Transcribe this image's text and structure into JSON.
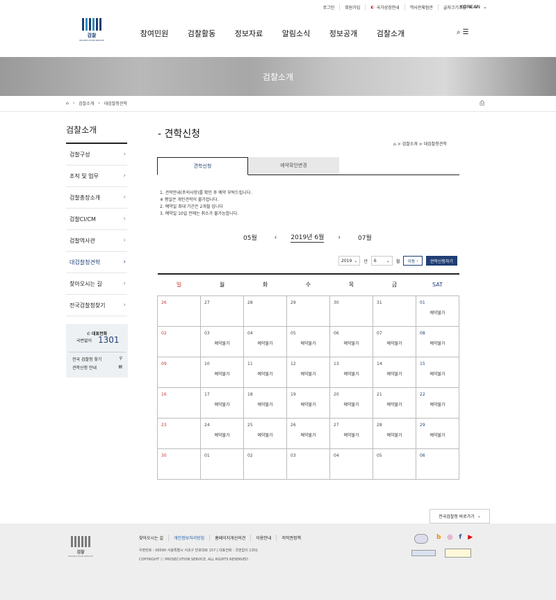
{
  "util_links": [
    "로그인",
    "회원가입",
    "국가상징안내",
    "역사관체험관",
    "글자크기조정"
  ],
  "language": "KOREAN",
  "logo": {
    "name": "검찰",
    "sub": "PROSECUTION SERVICE"
  },
  "gnb": [
    "참여민원",
    "검찰활동",
    "정보자료",
    "알림소식",
    "정보공개",
    "검찰소개"
  ],
  "hero_title": "검찰소개",
  "breadcrumb": [
    "검찰소개",
    "대검찰청견학"
  ],
  "sidebar": {
    "title": "검찰소개",
    "items": [
      "검찰구성",
      "조직 및 업무",
      "검찰총장소개",
      "검찰CI/CM",
      "검찰역사관",
      "대검찰청견학",
      "찾아오시는 길",
      "전국검찰청찾기"
    ],
    "call_label": "대표전화",
    "call_name": "국번없이",
    "call_number": "1301",
    "link1": "전국 검찰청 찾기",
    "link2": "견학신청 안내"
  },
  "page_title": "- 견학신청",
  "page_crumb": "> 검찰소개 > 대검찰청견학",
  "tabs": [
    "견학신청",
    "예약확인변경"
  ],
  "notes": [
    "1. 견학안내(주의사항)를 확인 후 예약 부탁드립니다.",
    "※ 평일은 개인견학이 불가합니다.",
    "2. 예약일 최대 기간은 2개월 입니다",
    "3. 예약일 10일 전에는 취소가 불가능합니다."
  ],
  "month_nav": {
    "prev": "05월",
    "current": "2019년 6월",
    "next": "07월"
  },
  "form": {
    "year": "2019",
    "year_unit": "년",
    "month": "6",
    "month_unit": "월",
    "go": "이동",
    "apply": "견학신청하기"
  },
  "weekdays": [
    "일",
    "월",
    "화",
    "수",
    "목",
    "금",
    "SAT"
  ],
  "calendar": [
    [
      {
        "d": "26",
        "r": ""
      },
      {
        "d": "27",
        "r": ""
      },
      {
        "d": "28",
        "r": ""
      },
      {
        "d": "29",
        "r": ""
      },
      {
        "d": "30",
        "r": ""
      },
      {
        "d": "31",
        "r": ""
      },
      {
        "d": "01",
        "r": "예약불가"
      }
    ],
    [
      {
        "d": "02",
        "r": ""
      },
      {
        "d": "03",
        "r": "예약불가"
      },
      {
        "d": "04",
        "r": "예약불가"
      },
      {
        "d": "05",
        "r": "예약불가"
      },
      {
        "d": "06",
        "r": "예약불가"
      },
      {
        "d": "07",
        "r": "예약불가"
      },
      {
        "d": "08",
        "r": "예약불가"
      }
    ],
    [
      {
        "d": "09",
        "r": ""
      },
      {
        "d": "10",
        "r": "예약불가"
      },
      {
        "d": "11",
        "r": "예약불가"
      },
      {
        "d": "12",
        "r": "예약불가"
      },
      {
        "d": "13",
        "r": "예약불가"
      },
      {
        "d": "14",
        "r": "예약불가"
      },
      {
        "d": "15",
        "r": "예약불가"
      }
    ],
    [
      {
        "d": "16",
        "r": ""
      },
      {
        "d": "17",
        "r": "예약불가"
      },
      {
        "d": "18",
        "r": "예약불가"
      },
      {
        "d": "19",
        "r": "예약불가"
      },
      {
        "d": "20",
        "r": "예약불가"
      },
      {
        "d": "21",
        "r": "예약불가"
      },
      {
        "d": "22",
        "r": "예약불가"
      }
    ],
    [
      {
        "d": "23",
        "r": ""
      },
      {
        "d": "24",
        "r": "예약불가"
      },
      {
        "d": "25",
        "r": "예약불가"
      },
      {
        "d": "26",
        "r": "예약불가"
      },
      {
        "d": "27",
        "r": "예약불가"
      },
      {
        "d": "28",
        "r": "예약불가"
      },
      {
        "d": "29",
        "r": "예약불가"
      }
    ],
    [
      {
        "d": "30",
        "r": ""
      },
      {
        "d": "01",
        "r": ""
      },
      {
        "d": "02",
        "r": ""
      },
      {
        "d": "03",
        "r": ""
      },
      {
        "d": "04",
        "r": ""
      },
      {
        "d": "05",
        "r": ""
      },
      {
        "d": "06",
        "r": ""
      }
    ]
  ],
  "quick_link": "전국검찰청 바로가기",
  "footer": {
    "links": [
      "찾아오시는 길",
      "개인정보처리방침",
      "홈페이지개선의견",
      "이용안내",
      "저작권정책"
    ],
    "address": "우편번호 : 06590 서울특별시 서초구 반포대로 157  |  대표전화 : 국번없이 1301",
    "copyright": "COPYRIGHT ⓒ PROSECUTION SERVICE. ALL RIGHTS RESERVED."
  },
  "colors": {
    "brand": "#1f3f74",
    "sunday": "#c0392b"
  }
}
